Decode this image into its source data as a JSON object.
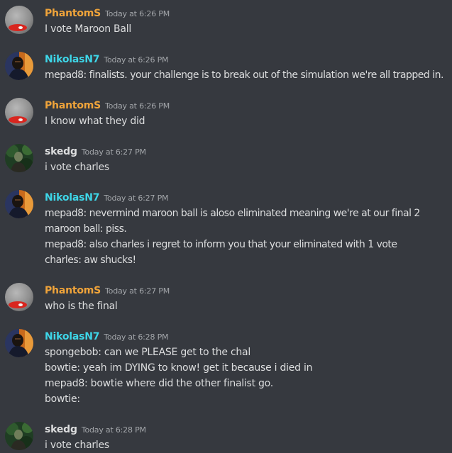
{
  "colors": {
    "background": "#36393f",
    "text": "#dcddde",
    "timestamp": "#a3a6aa"
  },
  "users": {
    "PhantomS": {
      "name": "PhantomS",
      "color": "#f0a43a",
      "avatar": "grey-orb-red-tag-avatar"
    },
    "NikolasN7": {
      "name": "NikolasN7",
      "color": "#3ed6e8",
      "avatar": "dark-figure-orange-backdrop-avatar"
    },
    "skedg": {
      "name": "skedg",
      "color": "#dcddde",
      "avatar": "green-forest-figure-avatar"
    }
  },
  "messages": [
    {
      "user": "PhantomS",
      "name": "PhantomS",
      "time": "Today at 6:26 PM",
      "lines": [
        "I vote Maroon Ball"
      ]
    },
    {
      "user": "NikolasN7",
      "name": "NikolasN7",
      "time": "Today at 6:26 PM",
      "lines": [
        "mepad8: finalists. your challenge is to break out of the simulation we're all trapped in."
      ]
    },
    {
      "user": "PhantomS",
      "name": "PhantomS",
      "time": "Today at 6:26 PM",
      "lines": [
        "I know what they did"
      ]
    },
    {
      "user": "skedg",
      "name": "skedg",
      "time": "Today at 6:27 PM",
      "lines": [
        "i vote charles"
      ]
    },
    {
      "user": "NikolasN7",
      "name": "NikolasN7",
      "time": "Today at 6:27 PM",
      "lines": [
        "mepad8: nevermind maroon ball is aloso eliminated meaning we're at our final 2",
        "maroon ball: piss.",
        "mepad8: also charles i regret to inform you that your eliminated with 1 vote",
        "charles: aw shucks!"
      ]
    },
    {
      "user": "PhantomS",
      "name": "PhantomS",
      "time": "Today at 6:27 PM",
      "lines": [
        "who is the final"
      ]
    },
    {
      "user": "NikolasN7",
      "name": "NikolasN7",
      "time": "Today at 6:28 PM",
      "lines": [
        "spongebob: can we PLEASE get to the chal",
        "bowtie: yeah im DYING to know! get it because i died in",
        "mepad8: bowtie where did the other finalist go.",
        "bowtie:"
      ]
    },
    {
      "user": "skedg",
      "name": "skedg",
      "time": "Today at 6:28 PM",
      "lines": [
        "i vote charles"
      ]
    }
  ]
}
